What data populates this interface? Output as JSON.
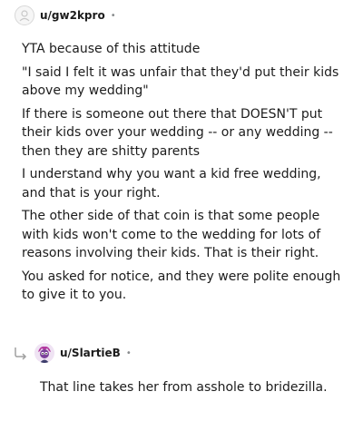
{
  "comment": {
    "username": "u/gw2kpro",
    "separator": "•",
    "paragraphs": [
      "YTA because of this attitude",
      "\"I said I felt it was unfair that they'd put their kids above my wedding\"",
      "If there is someone out there that DOESN'T put their kids over your wedding -- or any wedding -- then they are shitty parents",
      "I understand why you want a kid free wedding, and that is your right.",
      "The other side of that coin is that some people with kids won't come to the wedding for lots of reasons involving their kids. That is their right.",
      "You asked for notice, and they were polite enough to give it to you."
    ],
    "avatar_icon": "default-avatar-icon"
  },
  "reply": {
    "username": "u/SlartieB",
    "separator": "•",
    "text": "That line takes her from asshole to bridezilla.",
    "avatar_icon": "character-avatar-icon",
    "reply_icon": "reply-arrow-icon"
  },
  "colors": {
    "text": "#1c1c1c",
    "meta": "#878a8c",
    "avatar_pink": "#c13a9c"
  }
}
